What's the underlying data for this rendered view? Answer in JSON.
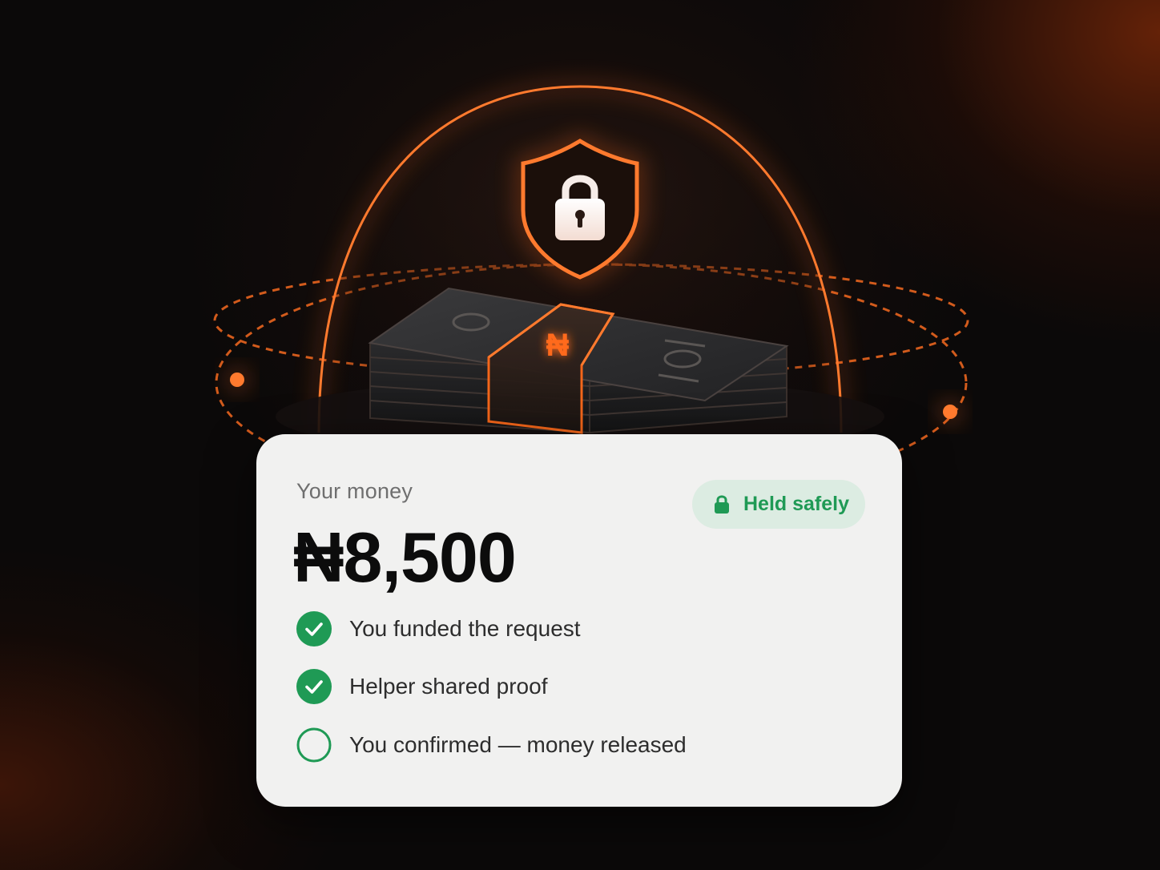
{
  "colors": {
    "accent": "#ff6a1a",
    "success": "#1f9a55",
    "success_badge_bg": "#dcece2",
    "card_bg": "#f1f1f0",
    "background": "#0b0909"
  },
  "hero": {
    "currency_symbol": "₦",
    "icons": [
      "shield-icon",
      "lock-icon",
      "cash-stack-icon"
    ]
  },
  "card": {
    "label": "Your money",
    "amount": "₦8,500",
    "badge": {
      "icon": "lock-icon",
      "label": "Held safely"
    },
    "steps": [
      {
        "label": "You funded the request",
        "status": "done",
        "icon": "check-circle-icon"
      },
      {
        "label": "Helper shared proof",
        "status": "done",
        "icon": "check-circle-icon"
      },
      {
        "label": "You confirmed — money released",
        "status": "pending",
        "icon": "empty-circle-icon"
      }
    ]
  }
}
